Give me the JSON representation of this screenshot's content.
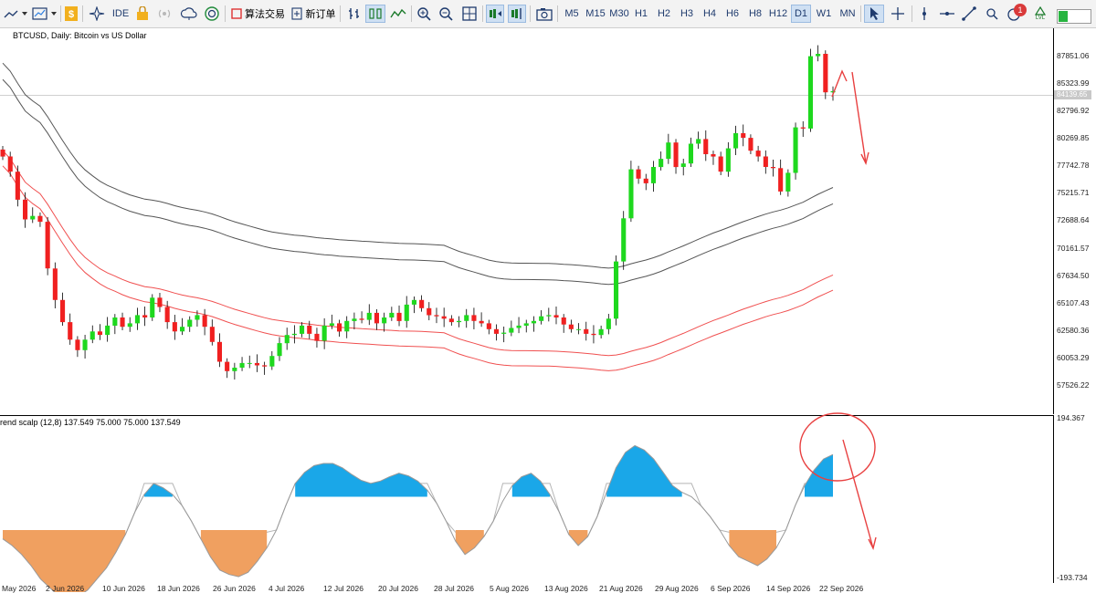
{
  "toolbar": {
    "ide_label": "IDE",
    "algo_trading_label": "算法交易",
    "new_order_label": "新订单",
    "notification_count": "1",
    "lvl_label": "LVL",
    "timeframes": [
      "M5",
      "M15",
      "M30",
      "H1",
      "H2",
      "H3",
      "H4",
      "H6",
      "H8",
      "H12",
      "D1",
      "W1",
      "MN"
    ],
    "active_timeframe": "D1",
    "icons": [
      "line-chart-icon",
      "area-chart-icon",
      "dollar-icon",
      "ide-icon",
      "lock-icon",
      "signal-icon",
      "cloud-icon",
      "vps-icon",
      "algo-trading-icon",
      "new-order-icon",
      "bars-icon",
      "candles-icon",
      "lines-icon",
      "zoom-in-icon",
      "zoom-out-icon",
      "grid-icon",
      "auto-scroll-icon",
      "chart-shift-icon",
      "screenshot-icon",
      "cursor-icon",
      "crosshair-icon",
      "vertical-line-icon",
      "horizontal-line-icon",
      "trend-line-icon",
      "search-icon",
      "notification-icon",
      "lvl-icon"
    ]
  },
  "chart": {
    "title": "BTCUSD, Daily:  Bitcoin vs US Dollar",
    "current_price": "84139.65",
    "price_labels": [
      "87851.06",
      "85323.99",
      "82796.92",
      "80269.85",
      "77742.78",
      "75215.71",
      "72688.64",
      "70161.57",
      "67634.50",
      "65107.43",
      "62580.36",
      "60053.29",
      "57526.22"
    ],
    "indicator_title": "rend scalp (12,8) 137.549 75.000 75.000 137.549",
    "indicator_max": "194.367",
    "indicator_min": "-193.734",
    "date_labels": [
      "May 2026",
      "2 Jun 2026",
      "10 Jun 2026",
      "18 Jun 2026",
      "26 Jun 2026",
      "4 Jul 2026",
      "12 Jul 2026",
      "20 Jul 2026",
      "28 Jul 2026",
      "5 Aug 2026",
      "13 Aug 2026",
      "21 Aug 2026",
      "29 Aug 2026",
      "6 Sep 2026",
      "14 Sep 2026",
      "22 Sep 2026"
    ],
    "colors": {
      "bull": "#1ed81e",
      "bear": "#f02020",
      "up_fill": "#1aa7e8",
      "down_fill": "#f0a060",
      "ma_gray": "#555555",
      "ma_red": "#f05050",
      "annotation": "#e84040"
    }
  },
  "chart_data": {
    "type": "candlestick",
    "symbol": "BTCUSD",
    "timeframe": "Daily",
    "y_range": [
      56800,
      89100
    ],
    "closes": [
      78500,
      77200,
      74800,
      73100,
      73400,
      72900,
      68900,
      66200,
      64300,
      62800,
      61900,
      62800,
      63500,
      63200,
      64000,
      64700,
      63900,
      64200,
      64900,
      64700,
      66400,
      65600,
      64300,
      63500,
      63900,
      64500,
      64900,
      63900,
      62600,
      60900,
      60100,
      60400,
      60800,
      60800,
      60600,
      60500,
      61400,
      62500,
      63200,
      63300,
      64000,
      63300,
      62700,
      64000,
      64200,
      63500,
      64400,
      64600,
      64500,
      65100,
      64200,
      64700,
      65100,
      64400,
      65800,
      66200,
      65500,
      64900,
      64800,
      64600,
      64300,
      64400,
      64900,
      64400,
      64200,
      63700,
      63300,
      63400,
      63800,
      64000,
      64200,
      64400,
      64800,
      64900,
      64700,
      64100,
      63700,
      63700,
      63300,
      63200,
      63700,
      64600,
      69500,
      73200,
      77400,
      76600,
      76200,
      77600,
      78300,
      79700,
      77600,
      77900,
      79600,
      80000,
      78700,
      78500,
      77200,
      79200,
      80500,
      80100,
      79000,
      78500,
      77600,
      77500,
      75500,
      77100,
      81000,
      80900,
      87100,
      87300,
      84000,
      84100
    ],
    "candle_dates_span": [
      "May 2026",
      "22 Sep 2026"
    ],
    "indicator": {
      "name": "rend scalp (12,8)",
      "values": [
        "137.549",
        "75.000",
        "75.000",
        "137.549"
      ],
      "range": [
        -193.734,
        194.367
      ],
      "line_series": [
        -20,
        -35,
        -55,
        -80,
        -110,
        -130,
        -150,
        -158,
        -150,
        -135,
        -110,
        -85,
        -50,
        -10,
        40,
        80,
        105,
        95,
        80,
        55,
        20,
        -20,
        -60,
        -90,
        -100,
        -105,
        -95,
        -70,
        -40,
        0,
        55,
        105,
        130,
        145,
        150,
        150,
        140,
        125,
        112,
        105,
        110,
        120,
        128,
        122,
        110,
        90,
        60,
        20,
        -25,
        -55,
        -40,
        -15,
        20,
        65,
        100,
        120,
        128,
        110,
        80,
        40,
        -10,
        -35,
        -15,
        30,
        85,
        140,
        175,
        190,
        180,
        160,
        130,
        100,
        85,
        75,
        55,
        30,
        0,
        -35,
        -60,
        -70,
        -80,
        -65,
        -40,
        0,
        55,
        100,
        135,
        160,
        170
      ]
    }
  }
}
